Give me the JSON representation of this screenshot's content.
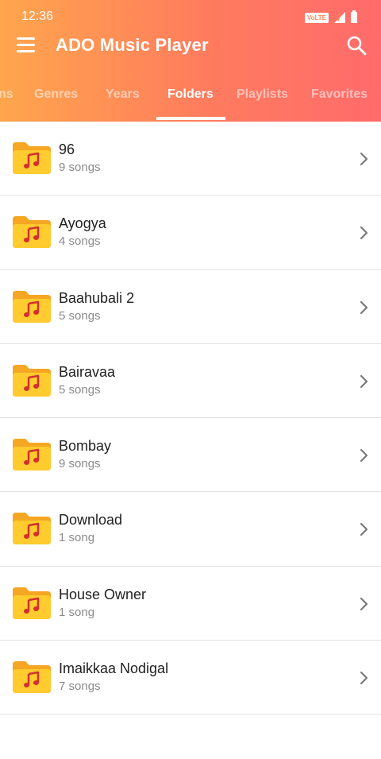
{
  "status_bar": {
    "time": "12:36",
    "volte": "VoLTE",
    "icons": [
      "volte-icon",
      "signal-icon",
      "battery-icon"
    ]
  },
  "app_bar": {
    "title": "ADO Music Player",
    "menu_icon": "hamburger-menu-icon",
    "search_icon": "search-icon"
  },
  "tabs": [
    {
      "label": "ns",
      "active": false
    },
    {
      "label": "Genres",
      "active": false
    },
    {
      "label": "Years",
      "active": false
    },
    {
      "label": "Folders",
      "active": true
    },
    {
      "label": "Playlists",
      "active": false
    },
    {
      "label": "Favorites",
      "active": false
    }
  ],
  "folders": [
    {
      "name": "96",
      "count": "9 songs"
    },
    {
      "name": "Ayogya",
      "count": "4 songs"
    },
    {
      "name": "Baahubali 2",
      "count": "5 songs"
    },
    {
      "name": "Bairavaa",
      "count": "5 songs"
    },
    {
      "name": "Bombay",
      "count": "9 songs"
    },
    {
      "name": "Download",
      "count": "1 song"
    },
    {
      "name": "House Owner",
      "count": "1 song"
    },
    {
      "name": "Imaikkaa Nodigal",
      "count": "7 songs"
    }
  ],
  "colors": {
    "header_gradient_start": "#ffa64d",
    "header_gradient_end": "#ff6b6b",
    "folder_back": "#f5a623",
    "folder_front": "#ffcb2e",
    "music_note": "#d32f2f",
    "chevron": "#7a7a7a"
  }
}
